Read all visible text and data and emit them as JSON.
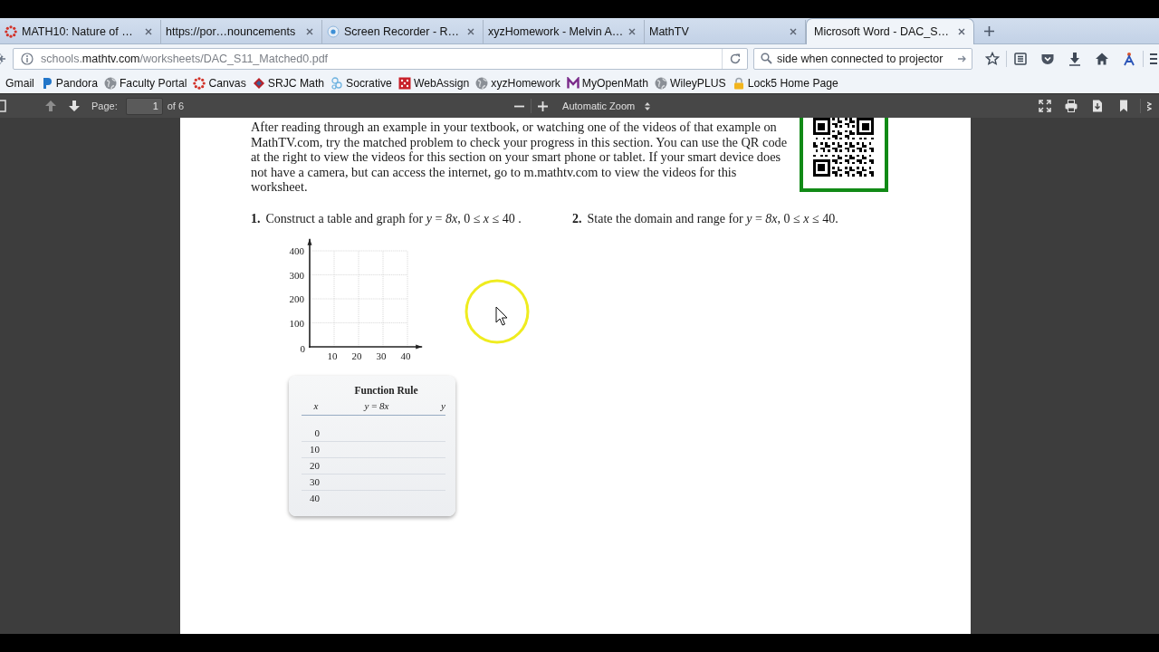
{
  "tabs": [
    {
      "label": "MATH10: Nature of …",
      "selected": false
    },
    {
      "label": "https://por…nouncements",
      "selected": false
    },
    {
      "label": "Screen Recorder - R…",
      "selected": false
    },
    {
      "label": "xyzHomework - Melvin A…",
      "selected": false
    },
    {
      "label": "MathTV",
      "selected": false
    },
    {
      "label": "Microsoft Word - DAC_S…",
      "selected": true
    }
  ],
  "address_bar": {
    "url_subdomain": "schools.",
    "url_domain": "mathtv.com",
    "url_path": "/worksheets/DAC_S11_Matched0.pdf"
  },
  "search_field": {
    "value": "side when connected to projector"
  },
  "bookmarks": [
    "Gmail",
    "Pandora",
    "Faculty Portal",
    "Canvas",
    "SRJC Math",
    "Socrative",
    "WebAssign",
    "xyzHomework",
    "MyOpenMath",
    "WileyPLUS",
    "Lock5 Home Page"
  ],
  "pdf_toolbar": {
    "page_buttons": [
      {
        "kind": "previous",
        "disabled": true
      },
      {
        "kind": "next",
        "disabled": false
      }
    ],
    "page_label": "Page:",
    "page_number": "1",
    "page_count": "of 6",
    "zoom": "Automatic Zoom"
  },
  "document": {
    "intro": "After reading through an example in your textbook, or watching one of the videos of that example on MathTV.com, try the matched problem to check your progress in this section. You can use the QR code at the right to view the videos for this section on your smart phone or tablet. If your smart device does not have a camera, but can access the internet, go to m.mathtv.com to view the videos for this worksheet.",
    "problems": [
      {
        "number": "1.",
        "text": "Construct a table and graph for  *y* = *8x*, 0 ≤ *x* ≤ 40 ."
      },
      {
        "number": "2.",
        "text": "State the domain and range for  *y* = *8x*, 0 ≤ *x* ≤ 40."
      }
    ],
    "graph": {
      "chart_data": {
        "type": "line",
        "xticks": [
          {
            "value": 10,
            "label": "10"
          },
          {
            "value": 20,
            "label": "20"
          },
          {
            "value": 30,
            "label": "30"
          },
          {
            "value": 40,
            "label": "40"
          }
        ],
        "yticks": [
          {
            "value": 0,
            "label": "0"
          },
          {
            "value": 100,
            "label": "100"
          },
          {
            "value": 200,
            "label": "200"
          },
          {
            "value": 300,
            "label": "300"
          },
          {
            "value": 400,
            "label": "400"
          }
        ],
        "xlim": [
          0,
          46
        ],
        "ylim": [
          0,
          450
        ],
        "grid": true
      }
    },
    "table": {
      "title": "Function Rule",
      "columns": [
        {
          "kind": "input",
          "label": "x"
        },
        {
          "kind": "rule",
          "label": "*y* = *8x*"
        },
        {
          "kind": "output",
          "label": "y"
        }
      ],
      "rows": [
        [
          "0"
        ],
        [
          "10"
        ],
        [
          "20"
        ],
        [
          "30"
        ],
        [
          "40"
        ]
      ]
    }
  }
}
